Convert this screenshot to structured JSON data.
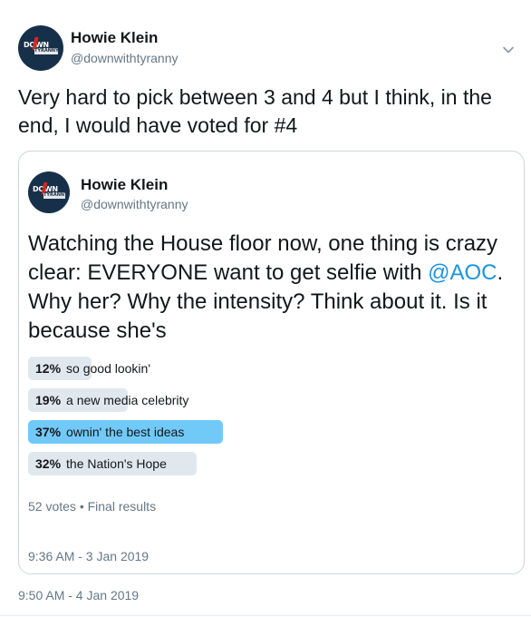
{
  "author": {
    "name": "Howie Klein",
    "handle": "@downwithtyranny",
    "avatar_logo_top": "DOWN",
    "avatar_logo_bottom": "TYRANNY"
  },
  "tweet": {
    "text": "Very hard to pick between 3 and 4 but I think, in the end, I would have voted for #4",
    "timestamp": "9:50 AM - 4 Jan 2019"
  },
  "quoted": {
    "name": "Howie Klein",
    "handle": "@downwithtyranny",
    "text_before": "Watching the House floor now, one thing is crazy clear: EVERYONE want to get selfie with ",
    "mention": "@AOC",
    "text_after": ". Why her? Why the intensity? Think about it. Is it because she's",
    "poll": {
      "options": [
        {
          "percent": "12%",
          "label": "so good lookin'",
          "value": 12
        },
        {
          "percent": "19%",
          "label": "a new media celebrity",
          "value": 19
        },
        {
          "percent": "37%",
          "label": "ownin' the best ideas",
          "value": 37
        },
        {
          "percent": "32%",
          "label": "the Nation's Hope",
          "value": 32
        }
      ],
      "meta": "52 votes • Final results"
    },
    "timestamp": "9:36 AM - 3 Jan 2019"
  },
  "colors": {
    "accent": "#1b95e0",
    "poll_leader": "#71c9f8",
    "poll_other": "#e1e8ed",
    "secondary_text": "#657786"
  },
  "icons": {
    "more": "chevron-down-icon"
  }
}
